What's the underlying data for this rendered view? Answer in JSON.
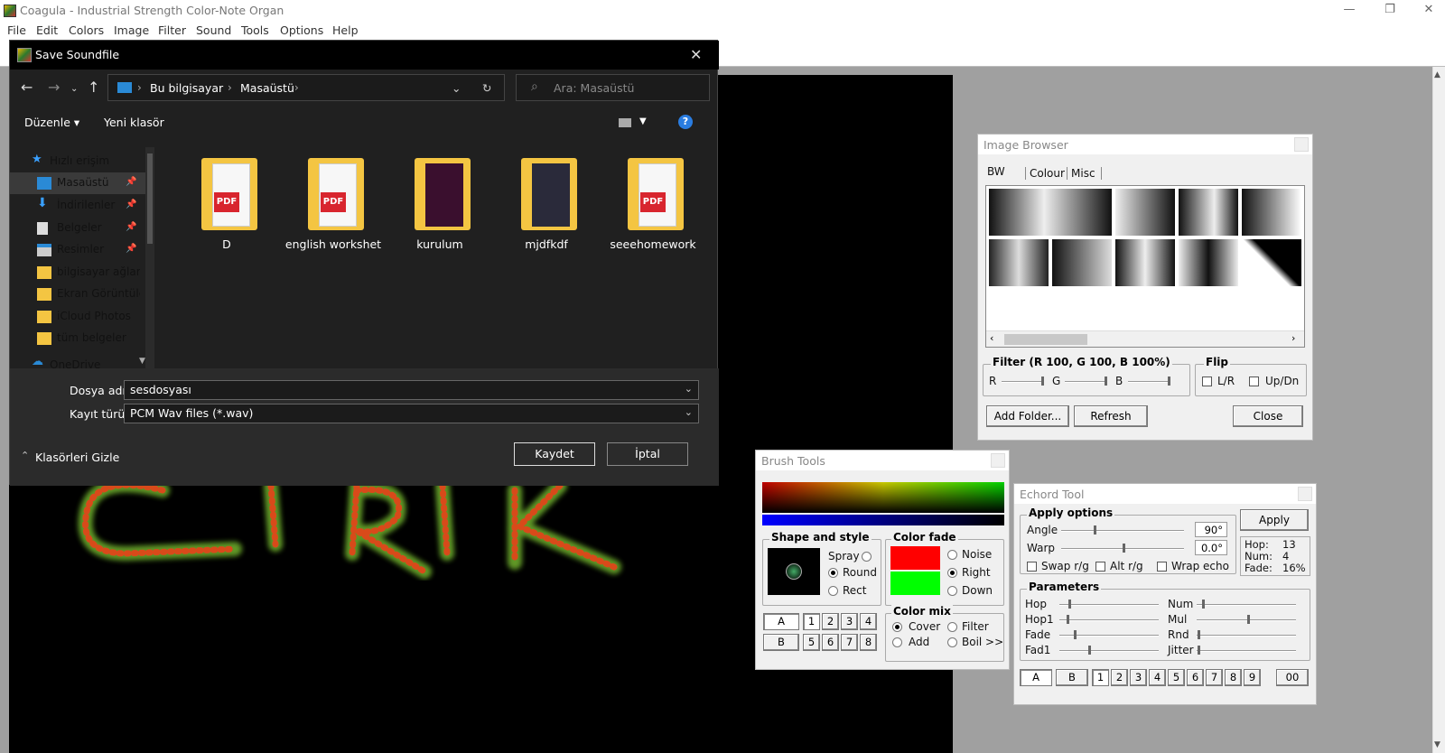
{
  "app": {
    "title": "Coagula - Industrial Strength Color-Note Organ"
  },
  "window_controls": {
    "minimize": "—",
    "maximize": "❐",
    "close": "✕"
  },
  "menu": [
    "File",
    "Edit",
    "Colors",
    "Image",
    "Filter",
    "Sound",
    "Tools",
    "Options",
    "Help"
  ],
  "canvas": {
    "text": "CIRIK"
  },
  "save_dialog": {
    "title": "Save Soundfile",
    "close": "✕",
    "breadcrumb": [
      "Bu bilgisayar",
      "Masaüstü"
    ],
    "search_placeholder": "Ara: Masaüstü",
    "commands": {
      "organize": "Düzenle ▾",
      "new_folder": "Yeni klasör",
      "help": "?"
    },
    "nav_items": [
      {
        "label": "Hızlı erişim",
        "icon": "star-icon",
        "pinned": false
      },
      {
        "label": "Masaüstü",
        "icon": "desktop-icon",
        "pinned": true
      },
      {
        "label": "İndirilenler",
        "icon": "download-icon",
        "pinned": true
      },
      {
        "label": "Belgeler",
        "icon": "documents-icon",
        "pinned": true
      },
      {
        "label": "Resimler",
        "icon": "pictures-icon",
        "pinned": true
      },
      {
        "label": "bilgisayar ağları",
        "icon": "folder-icon",
        "pinned": false
      },
      {
        "label": "Ekran Görüntüle",
        "icon": "folder-icon",
        "pinned": false
      },
      {
        "label": "iCloud Photos",
        "icon": "folder-icon",
        "pinned": false
      },
      {
        "label": "tüm belgeler",
        "icon": "folder-icon",
        "pinned": false
      },
      {
        "label": "OneDrive",
        "icon": "cloud-icon",
        "pinned": false
      }
    ],
    "folders": [
      {
        "name": "D",
        "style": "pdf"
      },
      {
        "name": "english workshet",
        "style": "pdf"
      },
      {
        "name": "kurulum",
        "style": "dark"
      },
      {
        "name": "mjdfkdf",
        "style": "dark"
      },
      {
        "name": "seeehomework",
        "style": "pdf"
      }
    ],
    "pdf_label": "PDF",
    "filename_label": "Dosya adı:",
    "filename_value": "sesdosyası",
    "filetype_label": "Kayıt türü:",
    "filetype_value": "PCM Wav files (*.wav)",
    "hide_folders": "Klasörleri Gizle",
    "save": "Kaydet",
    "cancel": "İptal"
  },
  "image_browser": {
    "title": "Image Browser",
    "tabs": [
      "BW",
      "Colour",
      "Misc"
    ],
    "filter_label": "Filter (R 100, G 100, B 100%)",
    "filter_channels": [
      "R",
      "G",
      "B"
    ],
    "flip_label": "Flip",
    "flip_lr": "L/R",
    "flip_updn": "Up/Dn",
    "add_folder": "Add Folder...",
    "refresh": "Refresh",
    "close": "Close"
  },
  "brush_tools": {
    "title": "Brush Tools",
    "shape_style": "Shape and style",
    "spray": "Spray",
    "round": "Round",
    "rect": "Rect",
    "color_fade": "Color fade",
    "noise": "Noise",
    "right": "Right",
    "down": "Down",
    "color_mix": "Color mix",
    "cover": "Cover",
    "filter": "Filter",
    "add": "Add",
    "boil": "Boil >>",
    "fade_colors": [
      "#ff0000",
      "#00ff00"
    ],
    "slot_a": "A",
    "slot_b": "B",
    "slots_row1": [
      "1",
      "2",
      "3",
      "4"
    ],
    "slots_row2": [
      "5",
      "6",
      "7",
      "8"
    ]
  },
  "echord_tool": {
    "title": "Echord Tool",
    "apply_options": "Apply options",
    "angle_label": "Angle",
    "angle_value": "90°",
    "warp_label": "Warp",
    "warp_value": "0.0°",
    "apply": "Apply",
    "hop_label": "Hop:",
    "hop_value": "13",
    "num_label": "Num:",
    "num_value": "4",
    "fade_label": "Fade:",
    "fade_value": "16%",
    "swap_rg": "Swap r/g",
    "alt_rg": "Alt r/g",
    "wrap_echo": "Wrap echo",
    "parameters": "Parameters",
    "params_left": [
      "Hop",
      "Hop1",
      "Fade",
      "Fad1"
    ],
    "params_right": [
      "Num",
      "Mul",
      "Rnd",
      "Jitter"
    ],
    "slot_a": "A",
    "slot_b": "B",
    "slots": [
      "1",
      "2",
      "3",
      "4",
      "5",
      "6",
      "7",
      "8",
      "9"
    ],
    "slot_00": "00"
  }
}
